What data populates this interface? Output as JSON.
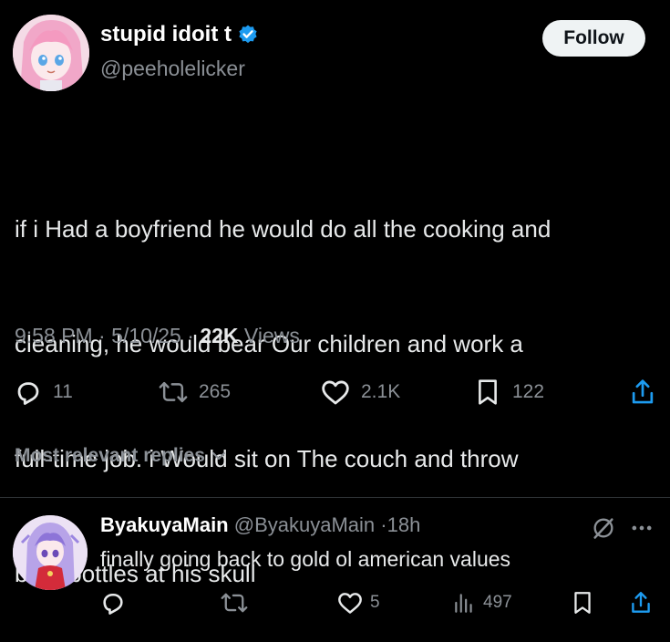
{
  "author": {
    "display_name": "stupid idoit t",
    "handle": "@peeholelicker",
    "verified_badge": "verified-icon"
  },
  "follow_button": "Follow",
  "tweet": {
    "lines": [
      "if i Had a boyfriend he would do all the cooking and",
      "cleaning, he would bear Our children and work a",
      "full-time job. i Would sit on The couch and throw",
      "beer bottles at his skull"
    ],
    "time": "9:58 PM",
    "sep1": "·",
    "date": "5/10/25",
    "sep2": "·",
    "views_count": "22K",
    "views_label": "Views"
  },
  "actions": {
    "replies": "11",
    "reposts": "265",
    "likes": "2.1K",
    "bookmarks": "122"
  },
  "replies_sort_label": "Most relevant replies",
  "reply": {
    "name": "ByakuyaMain",
    "handle": "@ByakuyaMain",
    "sep": "·",
    "age": "18h",
    "text": "finally going back to gold ol american values",
    "likes": "5",
    "views": "497"
  },
  "colors": {
    "background": "#000000",
    "text_primary": "#e7e9ea",
    "text_secondary": "#8b9096",
    "verified_blue": "#1d9bf0",
    "follow_bg": "#eff3f4"
  }
}
